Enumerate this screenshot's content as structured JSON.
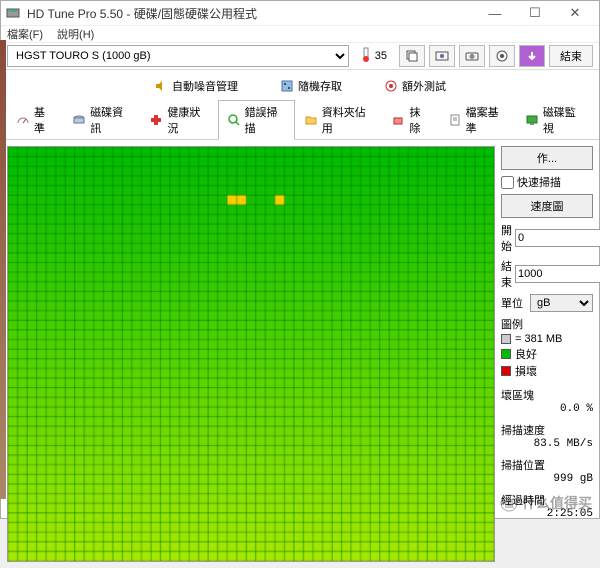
{
  "window": {
    "title": "HD Tune Pro 5.50 - 硬碟/固態硬碟公用程式"
  },
  "menu": {
    "file": "檔案(F)",
    "help": "說明(H)"
  },
  "toolbar": {
    "drive": "HGST    TOURO S (1000 gB)",
    "temp": "35",
    "end": "結束"
  },
  "tabs_row1": {
    "auto_noise": "自動噪音管理",
    "random_access": "隨機存取",
    "extra_test": "額外測試"
  },
  "tabs_row2": {
    "benchmark": "基準",
    "disk_info": "磁碟資訊",
    "health": "健康狀況",
    "error_scan": "錯誤掃描",
    "folder_usage": "資料夾佔用",
    "erase": "抹除",
    "file_bench": "檔案基準",
    "monitor": "磁碟監視"
  },
  "side": {
    "action_btn": "作...",
    "quick_scan": "快速掃描",
    "speed_map": "速度圖",
    "start_label": "開始",
    "start_val": "0",
    "end_label": "結束",
    "end_val": "1000",
    "unit_label": "單位",
    "unit_val": "gB",
    "legend_title": "圖例",
    "legend_block": "= 381 MB",
    "legend_ok": "良好",
    "legend_bad": "損壞",
    "bad_blocks_label": "壞區塊",
    "bad_blocks_val": "0.0 %",
    "scan_speed_label": "掃描速度",
    "scan_speed_val": "83.5 MB/s",
    "scan_pos_label": "掃描位置",
    "scan_pos_val": "999 gB",
    "elapsed_label": "經過時間",
    "elapsed_val": "2:25:05"
  },
  "watermark": "什么值得买",
  "colors": {
    "grid_top": "#00bb00",
    "grid_bottom": "#a8e800",
    "grid_line": "#006600",
    "bad_cell": "#ffcc00"
  }
}
